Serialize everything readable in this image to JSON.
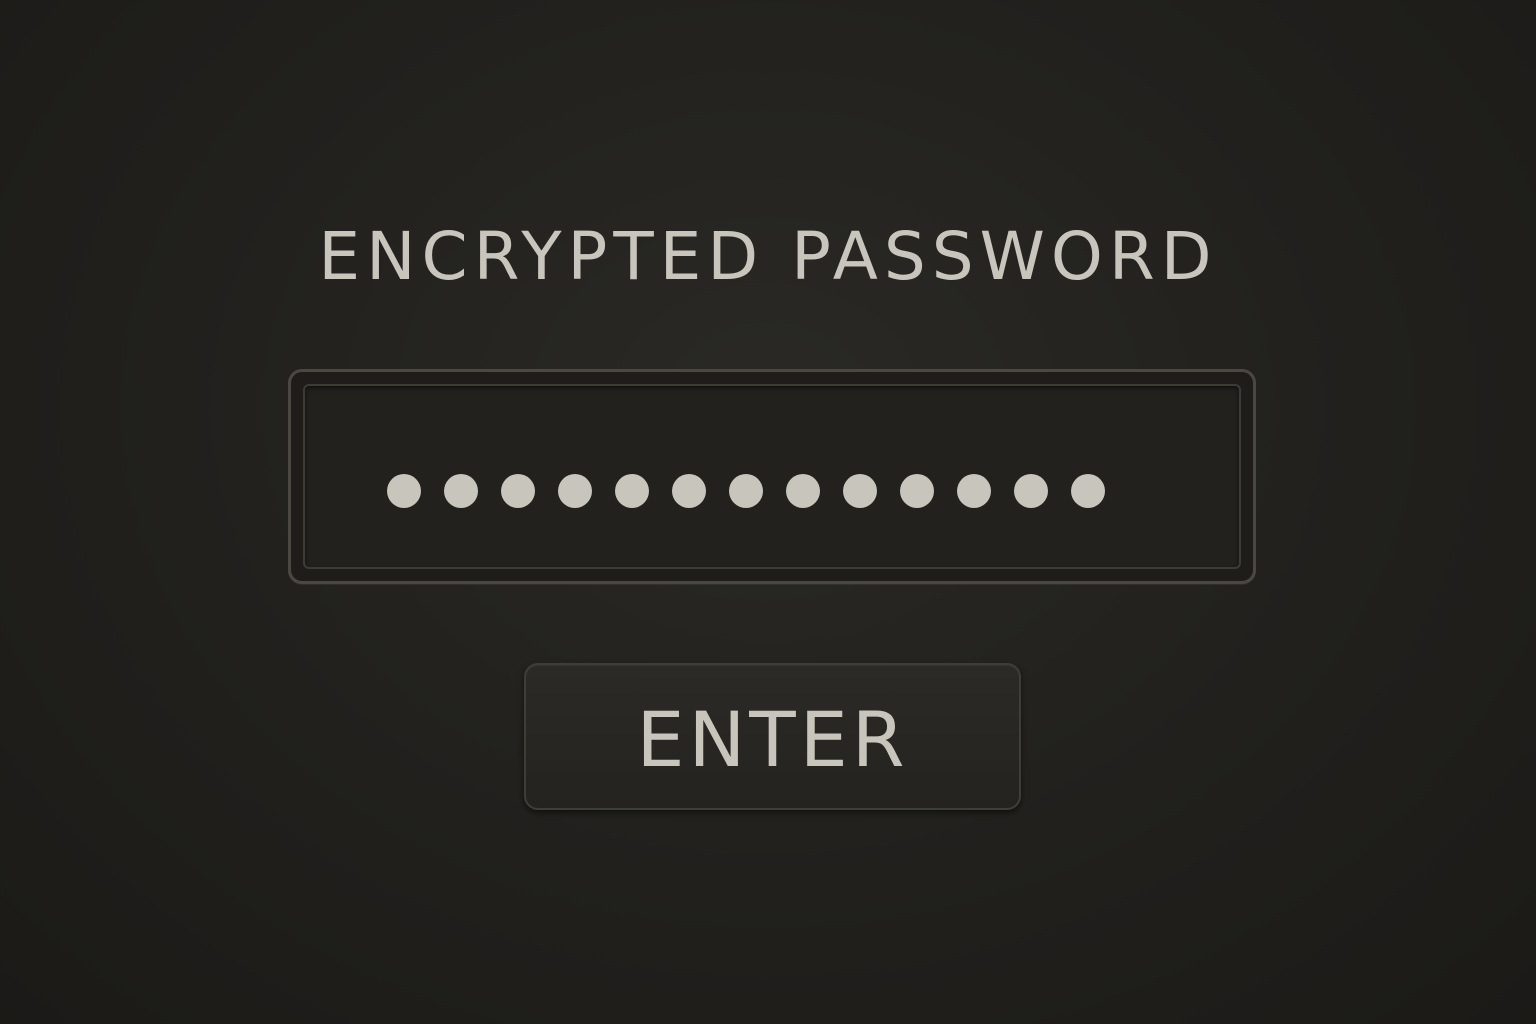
{
  "header": {
    "title": "ENCRYPTED PASSWORD"
  },
  "password_field": {
    "masked_char_count": 13,
    "mask_glyph": "dot"
  },
  "actions": {
    "enter_label": "ENTER"
  },
  "colors": {
    "background": "#21201d",
    "text": "#c8c5bd",
    "field_border": "#4a4840"
  }
}
